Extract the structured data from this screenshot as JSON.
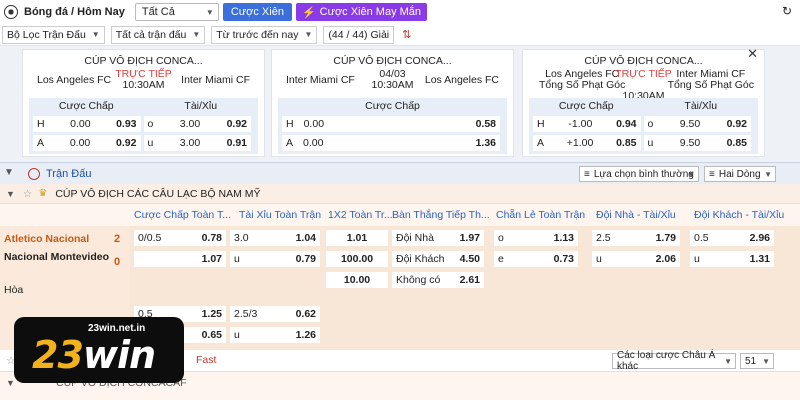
{
  "header": {
    "title": "Bóng đá / Hôm Nay",
    "select_all": "Tất Cả",
    "btn_cuoc_xien": "Cược Xiên",
    "btn_cuoc_xien_may_man": "Cược Xiên May Mắn"
  },
  "filters": {
    "loc_tran_dau": "Bộ Lọc Trận Đấu",
    "tat_ca_tran": "Tất cả trận đấu",
    "tu_truoc": "Từ trước đến nay",
    "giai_count": "(44 / 44) Giải"
  },
  "cards": [
    {
      "league": "CÚP VÔ ĐỊCH CONCA...",
      "home": "Los Angeles FC",
      "away": "Inter Miami CF",
      "status": "TRỰC TIẾP",
      "time": "10:30AM",
      "head_left": "Cược Chấp",
      "head_right": "Tài/Xỉu",
      "r1l": "H",
      "r1lv": "0.00",
      "r1lo": "0.93",
      "r1r": "o",
      "r1rv": "3.00",
      "r1ro": "0.92",
      "r2l": "A",
      "r2lv": "0.00",
      "r2lo": "0.92",
      "r2r": "u",
      "r2rv": "3.00",
      "r2ro": "0.91"
    },
    {
      "league": "CÚP VÔ ĐỊCH CONCA...",
      "home": "Inter Miami CF",
      "away": "Los Angeles FC",
      "date": "04/03",
      "time": "10:30AM",
      "head_left": "Cược Chấp",
      "r1l": "H",
      "r1lv": "0.00",
      "r1lo": "0.58",
      "r2l": "A",
      "r2lv": "0.00",
      "r2lo": "1.36"
    },
    {
      "league": "CÚP VÔ ĐỊCH CONCA...",
      "home": "Los Angeles FC",
      "home2": "Tổng Số Phạt Góc",
      "away": "Inter Miami CF",
      "away2": "Tổng Số Phạt Góc",
      "status": "TRỰC TIẾP",
      "time": "10:30AM",
      "head_left": "Cược Chấp",
      "head_right": "Tài/Xỉu",
      "r1l": "H",
      "r1lv": "-1.00",
      "r1lo": "0.94",
      "r1r": "o",
      "r1rv": "9.50",
      "r1ro": "0.92",
      "r2l": "A",
      "r2lv": "+1.00",
      "r2lo": "0.85",
      "r2r": "u",
      "r2rv": "9.50",
      "r2ro": "0.85"
    }
  ],
  "section": {
    "title": "Trận Đấu",
    "sort_select": "Lựa chọn bình thường",
    "line_select": "Hai Dòng"
  },
  "league_bar": {
    "name": "CÚP VÔ ĐỊCH CÁC CÂU LẠC BỘ NAM MỸ"
  },
  "columns": {
    "c1": "Cược Chấp Toàn T...",
    "c2": "Tài Xỉu Toàn Trận",
    "c3": "1X2 Toàn Tr...",
    "c4": "Bàn Thắng Tiếp Th...",
    "c5": "Chẵn Lẻ Toàn Trận",
    "c6": "Đội Nhà - Tài/Xỉu",
    "c7": "Đội Khách - Tài/Xỉu"
  },
  "match": {
    "home": "Atletico Nacional",
    "away": "Nacional Montevideo",
    "draw": "Hòa",
    "home_score": "2",
    "away_score": "0",
    "hcp1": "0/0.5",
    "hcp1o": "0.78",
    "hcp2o": "1.07",
    "ou1": "3.0",
    "ou1o": "1.04",
    "ou2": "u",
    "ou2o": "0.79",
    "x1": "1.01",
    "x2": "100.00",
    "x3": "10.00",
    "ng1": "Đội Nhà",
    "ng1o": "1.97",
    "ng2": "Đội Khách",
    "ng2o": "4.50",
    "ng3": "Không có",
    "ng3o": "2.61",
    "oe1": "o",
    "oe1o": "1.13",
    "oe2": "e",
    "oe2o": "0.73",
    "hou1": "2.5",
    "hou1o": "1.79",
    "hou2": "u",
    "hou2o": "2.06",
    "aou1": "0.5",
    "aou1o": "2.96",
    "aou2": "u",
    "aou2o": "1.31",
    "b_hcp1": "0.5",
    "b_hcp1o": "1.25",
    "b_hcp2o": "0.65",
    "b_ou1": "2.5/3",
    "b_ou1o": "0.62",
    "b_ou2": "u",
    "b_ou2o": "1.26"
  },
  "footer": {
    "fast": "Fast",
    "other_bets": "Các loại cược Châu Á khác",
    "count": "51"
  },
  "next_league": "CÚP VÔ ĐỊCH CONCACAF",
  "logo": {
    "site": "23win.net.in",
    "brand_num": "23",
    "brand_word": "win"
  },
  "colors": {
    "accent_blue": "#3b6fd9",
    "accent_purple": "#8a3be8",
    "live_red": "#e23d3d",
    "team_orange": "#c95a14"
  }
}
